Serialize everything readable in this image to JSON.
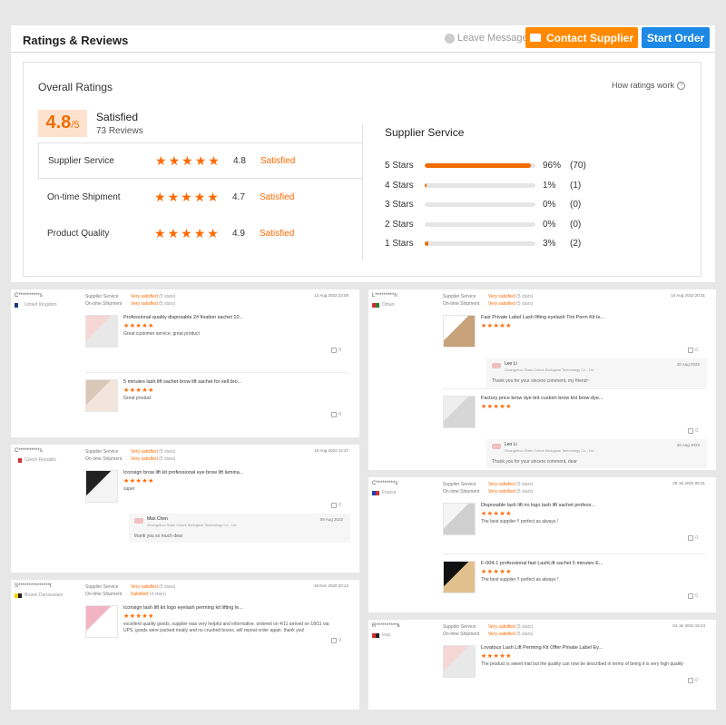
{
  "header": {
    "title": "Ratings & Reviews",
    "leave_messages": "Leave Messages",
    "contact_supplier": "Contact Supplier",
    "start_order": "Start Order"
  },
  "overall": {
    "title": "Overall Ratings",
    "how": "How ratings work",
    "score": "4.8",
    "score_max": "/5",
    "summary": "Satisfied",
    "reviews": "73 Reviews",
    "rows": [
      {
        "label": "Supplier Service",
        "value": "4.8",
        "text": "Satisfied",
        "stars": 5
      },
      {
        "label": "On-time Shipment",
        "value": "4.7",
        "text": "Satisfied",
        "stars": 4.7
      },
      {
        "label": "Product Quality",
        "value": "4.9",
        "text": "Satisfied",
        "stars": 5
      }
    ]
  },
  "supplier_service": {
    "title": "Supplier Service",
    "rows": [
      {
        "label": "5 Stars",
        "pct": "96%",
        "count": "(70)",
        "fill": 0.96
      },
      {
        "label": "4 Stars",
        "pct": "1%",
        "count": "(1)",
        "fill": 0.01
      },
      {
        "label": "3 Stars",
        "pct": "0%",
        "count": "(0)",
        "fill": 0
      },
      {
        "label": "2 Stars",
        "pct": "0%",
        "count": "(0)",
        "fill": 0
      },
      {
        "label": "1 Stars",
        "pct": "3%",
        "count": "(2)",
        "fill": 0.03
      }
    ]
  },
  "reviews": [
    {
      "name": "C**********s",
      "country": "United Kingdom",
      "date": "12 Aug 2022 23:08",
      "ss_label": "Supplier Service",
      "os_label": "On-time Shipment",
      "ss": "Very satisfied",
      "ss_stars": "(5 stars)",
      "os": "Very satisfied",
      "os_stars": "(5 stars)",
      "products": [
        {
          "title": "Professional quality disposable 2# fixation sachet 10...",
          "text": "Great customer service, great product",
          "likes": "0"
        },
        {
          "title": "5 minutes lash lift sachet brow lift sachet for sell bro...",
          "text": "Great product",
          "likes": "0"
        }
      ]
    },
    {
      "name": "C**********s",
      "country": "Czech Republic",
      "date": "19 Aug 2022 12:27",
      "ss": "Very satisfied",
      "ss_stars": "(5 stars)",
      "os": "Very satisfied",
      "os_stars": "(5 stars)",
      "products": [
        {
          "title": "Iconsign brow lift kit professional eye brow lift lamina...",
          "text": "super",
          "likes": "0",
          "reply": {
            "name": "Max Chen",
            "company": "Guangzhou Stars Colors Biological Technology Co., Ltd",
            "date": "09 Aug 2022",
            "text": "thank you so much dear"
          }
        }
      ]
    },
    {
      "name": "S***************t",
      "country": "Brunei Darussalam",
      "date": "18 Nov 2020 20:12",
      "ss": "Very satisfied",
      "ss_stars": "(5 stars)",
      "os": "Satisfied",
      "os_stars": "(4 stars)",
      "products": [
        {
          "title": "Iconsign lash lift kit logo eyelash perming kit lifting le...",
          "text": "excellent quality goods, supplier was very helpful and informative. ordered on 4/11 arrived on 18/11 via UPS. goods were packed neatly and no crushed boxes. will repeat order again. thank you!",
          "likes": "0"
        }
      ]
    },
    {
      "name": "L*********n",
      "country": "Oman",
      "date": "10 Aug 2022 20:31",
      "ss": "Very satisfied",
      "ss_stars": "(5 stars)",
      "os": "Very satisfied",
      "os_stars": "(5 stars)",
      "products": [
        {
          "title": "Fast Private Label Lash lifting eyelash Tint Perm Kit le...",
          "text": "",
          "likes": "0",
          "reply": {
            "name": "Leo Li",
            "company": "Guangzhou Stars Colors Biological Technology Co., Ltd",
            "date": "10 Aug 2022",
            "text": "Thank you for your sincere comment, my friend~"
          }
        },
        {
          "title": "Factory price brow dye tint custom brow tint brow dye...",
          "text": "",
          "likes": "0",
          "reply": {
            "name": "Leo Li",
            "company": "Guangzhou Stars Colors Biological Technology Co., Ltd",
            "date": "10 Aug 2022",
            "text": "Thank you for your sincere comment, dear"
          }
        }
      ]
    },
    {
      "name": "C*********s",
      "country": "France",
      "date": "28 Jul 2022 06:31",
      "ss": "Very satisfied",
      "ss_stars": "(5 stars)",
      "os": "Very satisfied",
      "os_stars": "(5 stars)",
      "products": [
        {
          "title": "Disposable lash lift no logo lash lift sachet profess...",
          "text": "The best supplier !! perfect as always !",
          "likes": "0"
        },
        {
          "title": "F-004-1 professional fast LashLift sachet 5 minutes E...",
          "text": "The best supplier !! perfect as always !",
          "likes": "0"
        }
      ]
    },
    {
      "name": "R**********k",
      "country": "Iraq",
      "date": "04 Jul 2022 15:24",
      "ss": "Very satisfied",
      "ss_stars": "(5 stars)",
      "os": "Very satisfied",
      "os_stars": "(5 stars)",
      "products": [
        {
          "title": "Lovatous Lash Lift Perming Kit Offer Private Label Ey...",
          "text": "The product is sweet trial but the quality can now be described in terms of being it is very high quality",
          "likes": "0"
        }
      ]
    }
  ],
  "colors": {
    "accent": "#ff6a00",
    "blue": "#1e88e5",
    "orange_btn": "#ff8a00"
  }
}
